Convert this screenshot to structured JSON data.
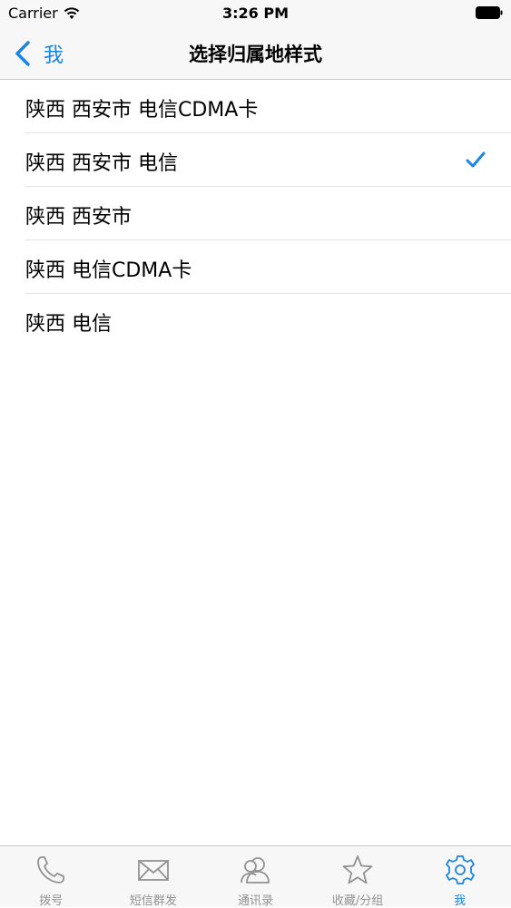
{
  "status_bar": {
    "carrier": "Carrier",
    "time": "3:26 PM"
  },
  "nav": {
    "back_label": "我",
    "title": "选择归属地样式"
  },
  "options": [
    {
      "label": "陕西 西安市 电信CDMA卡",
      "selected": false
    },
    {
      "label": "陕西 西安市 电信",
      "selected": true
    },
    {
      "label": "陕西 西安市",
      "selected": false
    },
    {
      "label": "陕西 电信CDMA卡",
      "selected": false
    },
    {
      "label": "陕西 电信",
      "selected": false
    }
  ],
  "tabs": [
    {
      "label": "拨号",
      "icon": "phone-icon",
      "active": false
    },
    {
      "label": "短信群发",
      "icon": "envelope-icon",
      "active": false
    },
    {
      "label": "通讯录",
      "icon": "contacts-icon",
      "active": false
    },
    {
      "label": "收藏/分组",
      "icon": "star-icon",
      "active": false
    },
    {
      "label": "我",
      "icon": "gear-icon",
      "active": true
    }
  ],
  "colors": {
    "accent": "#1a85e2",
    "inactive": "#929292",
    "bar_background": "#f7f7f7"
  }
}
